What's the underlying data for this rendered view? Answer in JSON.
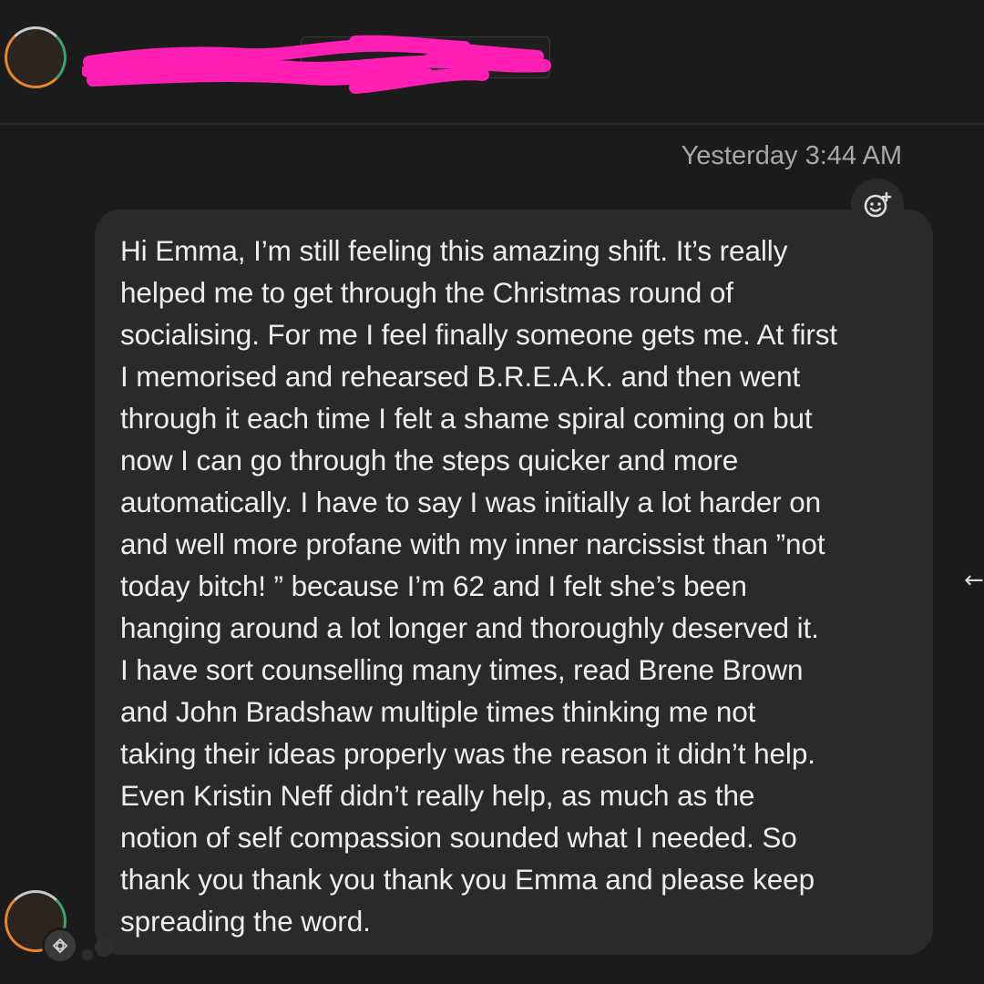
{
  "header": {
    "sender_name": "",
    "badge_label": ""
  },
  "conversation": {
    "timestamp": "Yesterday 3:44 AM",
    "message_text": "Hi Emma, I’m still feeling this amazing shift. It’s really\nhelped me to get through the Christmas round of\nsocialising. For me I feel finally someone gets me. At first\nI memorised and rehearsed B.R.E.A.K. and then went\nthrough it each time I felt a shame spiral coming on but\nnow I can go through the steps quicker and more\nautomatically. I have to say I was initially a lot harder on\nand well more profane with my inner narcissist than ”not\ntoday bitch! ” because I’m 62 and I felt she’s been\nhanging around a lot longer and thoroughly deserved it.\nI have sort counselling many times, read Brene Brown\nand John Bradshaw multiple times thinking me not\ntaking their ideas properly was the reason it didn’t help.\nEven Kristin Neff didn’t really help, as much as the\nnotion of self compassion sounded what I needed. So\nthank you thank you thank you Emma and please keep\nspreading the word."
  },
  "icons": {
    "react": "add-reaction-icon",
    "reply": "reply-arrow-icon",
    "status": "badge-icon"
  },
  "colors": {
    "background": "#1b1b1c",
    "bubble": "#2a2a2c",
    "redaction": "#ff1fb4",
    "text": "#ededee",
    "timestamp": "#a8a8aa"
  }
}
